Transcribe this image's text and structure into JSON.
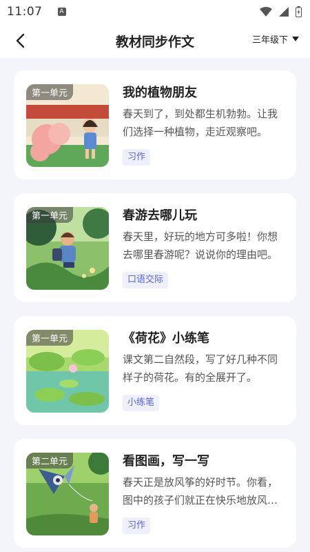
{
  "status_bar": {
    "time": "11:07",
    "notification_glyph": "A"
  },
  "header": {
    "title": "教材同步作文",
    "grade": "三年级下"
  },
  "cards": [
    {
      "unit": "第一单元",
      "title": "我的植物朋友",
      "description": "春天到了，到处都生机勃勃。让我们选择一种植物，走近观察吧。",
      "tag": "习作"
    },
    {
      "unit": "第一单元",
      "title": "春游去哪儿玩",
      "description": "春天里，好玩的地方可多啦！你想去哪里春游呢？说说你的理由吧。",
      "tag": "口语交际"
    },
    {
      "unit": "第一单元",
      "title": "《荷花》小练笔",
      "description": "课文第二自然段，写了好几种不同样子的荷花。有的全展开了。",
      "tag": "小练笔"
    },
    {
      "unit": "第二单元",
      "title": "看图画，写一写",
      "description": "春天正是放风筝的好时节。你看，图中的孩子们就正在快乐地放风筝。",
      "tag": "习作"
    }
  ],
  "colors": {
    "accent": "#5b63d8",
    "tag_bg": "#eef0fe",
    "page_bg": "#f4f5fb"
  }
}
